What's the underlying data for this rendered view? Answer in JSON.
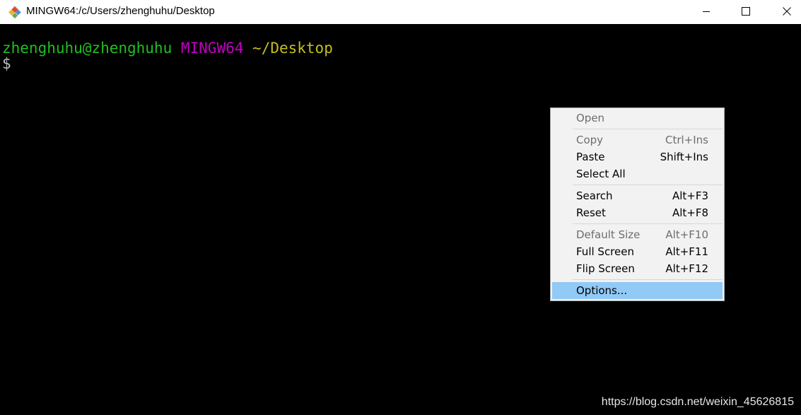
{
  "window": {
    "title": "MINGW64:/c/Users/zhenghuhu/Desktop",
    "app_icon": "git-bash-icon",
    "controls": {
      "minimize": "minimize-icon",
      "maximize": "maximize-icon",
      "close": "close-icon"
    }
  },
  "terminal": {
    "user_host": "zhenghuhu@zhenghuhu",
    "env": "MINGW64",
    "path": "~/Desktop",
    "prompt_symbol": "$",
    "colors": {
      "background": "#000000",
      "user_host": "#1fc01f",
      "env": "#bf00bf",
      "path": "#c0bf1f"
    }
  },
  "context_menu": {
    "items": [
      {
        "label": "Open",
        "shortcut": "",
        "disabled": true
      },
      {
        "label": "Copy",
        "shortcut": "Ctrl+Ins",
        "disabled": true
      },
      {
        "label": "Paste",
        "shortcut": "Shift+Ins",
        "disabled": false
      },
      {
        "label": "Select All",
        "shortcut": "",
        "disabled": false
      },
      {
        "label": "Search",
        "shortcut": "Alt+F3",
        "disabled": false
      },
      {
        "label": "Reset",
        "shortcut": "Alt+F8",
        "disabled": false
      },
      {
        "label": "Default Size",
        "shortcut": "Alt+F10",
        "disabled": true
      },
      {
        "label": "Full Screen",
        "shortcut": "Alt+F11",
        "disabled": false
      },
      {
        "label": "Flip Screen",
        "shortcut": "Alt+F12",
        "disabled": false
      },
      {
        "label": "Options...",
        "shortcut": "",
        "disabled": false,
        "highlighted": true
      }
    ],
    "highlight_color": "#91c9f7"
  },
  "watermark": "https://blog.csdn.net/weixin_45626815"
}
